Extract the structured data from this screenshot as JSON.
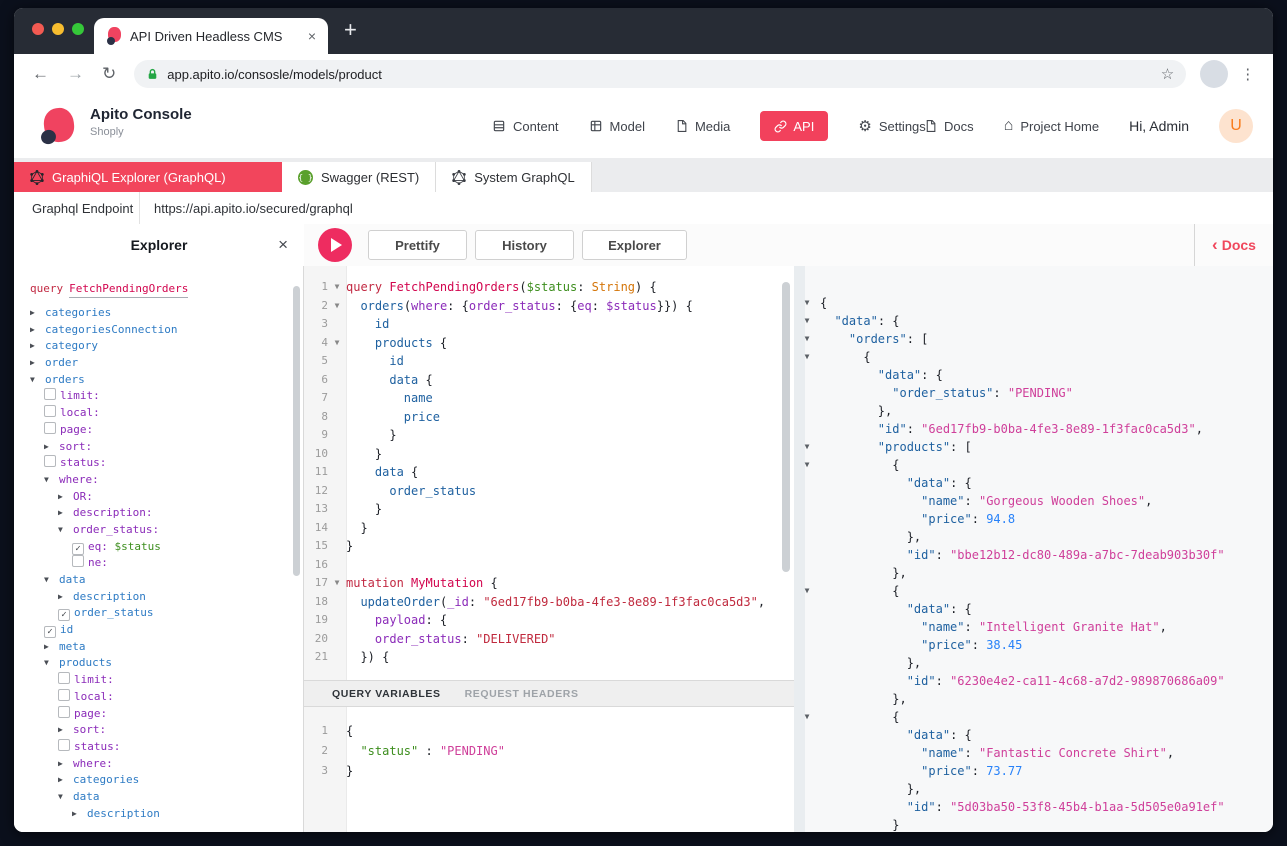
{
  "browser": {
    "tab_title": "API Driven Headless CMS",
    "close": "×",
    "new_tab": "+",
    "back": "←",
    "forward": "→",
    "reload": "↻",
    "url": "app.apito.io/consosle/models/product",
    "star": "☆",
    "menu": "⋮"
  },
  "header": {
    "brand": "Apito Console",
    "project": "Shoply",
    "nav": [
      {
        "label": "Content"
      },
      {
        "label": "Model"
      },
      {
        "label": "Media"
      },
      {
        "label": "API"
      },
      {
        "label": "Settings"
      }
    ],
    "settings_gear": "⚙",
    "right": {
      "docs": "Docs",
      "home_glyph": "⌂",
      "project_home": "Project Home",
      "greeting": "Hi, Admin",
      "avatar": "U"
    }
  },
  "api_tabs": [
    {
      "label": "GraphiQL Explorer (GraphQL)",
      "active": true
    },
    {
      "label": "Swagger (REST)",
      "active": false
    },
    {
      "label": "System GraphQL",
      "active": false
    }
  ],
  "endpoint": {
    "label": "Graphql Endpoint",
    "url": "https://api.apito.io/secured/graphql"
  },
  "toolbar": {
    "panel_title": "Explorer",
    "close": "×",
    "buttons": [
      "Prettify",
      "History",
      "Explorer"
    ],
    "docs_chevron": "‹",
    "docs_link": "Docs"
  },
  "explorer_tree": {
    "operation": "query",
    "operation_name": "FetchPendingOrders",
    "items": [
      {
        "ind": 0,
        "ctrl": "c",
        "label": "categories",
        "cls": "f"
      },
      {
        "ind": 0,
        "ctrl": "c",
        "label": "categoriesConnection",
        "cls": "f"
      },
      {
        "ind": 0,
        "ctrl": "c",
        "label": "category",
        "cls": "f"
      },
      {
        "ind": 0,
        "ctrl": "c",
        "label": "order",
        "cls": "f"
      },
      {
        "ind": 0,
        "ctrl": "o",
        "label": "orders",
        "cls": "f"
      },
      {
        "ind": 1,
        "ctrl": "b",
        "label": "limit:",
        "cls": "a"
      },
      {
        "ind": 1,
        "ctrl": "b",
        "label": "local:",
        "cls": "a"
      },
      {
        "ind": 1,
        "ctrl": "b",
        "label": "page:",
        "cls": "a"
      },
      {
        "ind": 1,
        "ctrl": "c",
        "label": "sort:",
        "cls": "a"
      },
      {
        "ind": 1,
        "ctrl": "b",
        "label": "status:",
        "cls": "a"
      },
      {
        "ind": 1,
        "ctrl": "o",
        "label": "where:",
        "cls": "a"
      },
      {
        "ind": 2,
        "ctrl": "c",
        "label": "OR:",
        "cls": "a"
      },
      {
        "ind": 2,
        "ctrl": "c",
        "label": "description:",
        "cls": "a"
      },
      {
        "ind": 2,
        "ctrl": "o",
        "label": "order_status:",
        "cls": "a"
      },
      {
        "ind": 3,
        "ctrl": "x",
        "label": "eq:",
        "cls": "a",
        "extra": "$status"
      },
      {
        "ind": 3,
        "ctrl": "b",
        "label": "ne:",
        "cls": "a"
      },
      {
        "ind": 1,
        "ctrl": "o",
        "label": "data",
        "cls": "f"
      },
      {
        "ind": 2,
        "ctrl": "c",
        "label": "description",
        "cls": "f"
      },
      {
        "ind": 2,
        "ctrl": "x",
        "label": "order_status",
        "cls": "f"
      },
      {
        "ind": 1,
        "ctrl": "x",
        "label": "id",
        "cls": "f"
      },
      {
        "ind": 1,
        "ctrl": "c",
        "label": "meta",
        "cls": "f"
      },
      {
        "ind": 1,
        "ctrl": "o",
        "label": "products",
        "cls": "f"
      },
      {
        "ind": 2,
        "ctrl": "b",
        "label": "limit:",
        "cls": "a"
      },
      {
        "ind": 2,
        "ctrl": "b",
        "label": "local:",
        "cls": "a"
      },
      {
        "ind": 2,
        "ctrl": "b",
        "label": "page:",
        "cls": "a"
      },
      {
        "ind": 2,
        "ctrl": "c",
        "label": "sort:",
        "cls": "a"
      },
      {
        "ind": 2,
        "ctrl": "b",
        "label": "status:",
        "cls": "a"
      },
      {
        "ind": 2,
        "ctrl": "c",
        "label": "where:",
        "cls": "a"
      },
      {
        "ind": 2,
        "ctrl": "c",
        "label": "categories",
        "cls": "f"
      },
      {
        "ind": 2,
        "ctrl": "o",
        "label": "data",
        "cls": "f"
      },
      {
        "ind": 3,
        "ctrl": "c",
        "label": "description",
        "cls": "f"
      }
    ]
  },
  "editor": {
    "lines": [
      {
        "n": 1,
        "fold": true,
        "seg": [
          [
            "k",
            "query "
          ],
          [
            "d",
            "FetchPendingOrders"
          ],
          [
            "p",
            "("
          ],
          [
            "v",
            "$status"
          ],
          [
            "p",
            ": "
          ],
          [
            "t",
            "String"
          ],
          [
            "p",
            ") {"
          ]
        ]
      },
      {
        "n": 2,
        "fold": true,
        "seg": [
          [
            "p",
            "  "
          ],
          [
            "f",
            "orders"
          ],
          [
            "p",
            "("
          ],
          [
            "a",
            "where"
          ],
          [
            "p",
            ": {"
          ],
          [
            "a",
            "order_status"
          ],
          [
            "p",
            ": {"
          ],
          [
            "a",
            "eq"
          ],
          [
            "p",
            ": "
          ],
          [
            "a",
            "$status"
          ],
          [
            "p",
            "}}) {"
          ]
        ]
      },
      {
        "n": 3,
        "fold": false,
        "seg": [
          [
            "p",
            "    "
          ],
          [
            "f",
            "id"
          ]
        ]
      },
      {
        "n": 4,
        "fold": true,
        "seg": [
          [
            "p",
            "    "
          ],
          [
            "f",
            "products"
          ],
          [
            "p",
            " {"
          ]
        ]
      },
      {
        "n": 5,
        "fold": false,
        "seg": [
          [
            "p",
            "      "
          ],
          [
            "f",
            "id"
          ]
        ]
      },
      {
        "n": 6,
        "fold": false,
        "seg": [
          [
            "p",
            "      "
          ],
          [
            "f",
            "data"
          ],
          [
            "p",
            " {"
          ]
        ]
      },
      {
        "n": 7,
        "fold": false,
        "seg": [
          [
            "p",
            "        "
          ],
          [
            "f",
            "name"
          ]
        ]
      },
      {
        "n": 8,
        "fold": false,
        "seg": [
          [
            "p",
            "        "
          ],
          [
            "f",
            "price"
          ]
        ]
      },
      {
        "n": 9,
        "fold": false,
        "seg": [
          [
            "p",
            "      }"
          ]
        ]
      },
      {
        "n": 10,
        "fold": false,
        "seg": [
          [
            "p",
            "    }"
          ]
        ]
      },
      {
        "n": 11,
        "fold": false,
        "seg": [
          [
            "p",
            "    "
          ],
          [
            "f",
            "data"
          ],
          [
            "p",
            " {"
          ]
        ]
      },
      {
        "n": 12,
        "fold": false,
        "seg": [
          [
            "p",
            "      "
          ],
          [
            "f",
            "order_status"
          ]
        ]
      },
      {
        "n": 13,
        "fold": false,
        "seg": [
          [
            "p",
            "    }"
          ]
        ]
      },
      {
        "n": 14,
        "fold": false,
        "seg": [
          [
            "p",
            "  }"
          ]
        ]
      },
      {
        "n": 15,
        "fold": false,
        "seg": [
          [
            "p",
            "}"
          ]
        ]
      },
      {
        "n": 16,
        "fold": false,
        "seg": []
      },
      {
        "n": 17,
        "fold": true,
        "seg": [
          [
            "k",
            "mutation "
          ],
          [
            "d",
            "MyMutation"
          ],
          [
            "p",
            " {"
          ]
        ]
      },
      {
        "n": 18,
        "fold": false,
        "seg": [
          [
            "p",
            "  "
          ],
          [
            "f",
            "updateOrder"
          ],
          [
            "p",
            "("
          ],
          [
            "a",
            "_id"
          ],
          [
            "p",
            ": "
          ],
          [
            "s",
            "\"6ed17fb9-b0ba-4fe3-8e89-1f3fac0ca5d3\""
          ],
          [
            "p",
            ","
          ]
        ]
      },
      {
        "n": 19,
        "fold": false,
        "seg": [
          [
            "p",
            "    "
          ],
          [
            "a",
            "payload"
          ],
          [
            "p",
            ": {"
          ]
        ]
      },
      {
        "n": 20,
        "fold": false,
        "seg": [
          [
            "p",
            "    "
          ],
          [
            "a",
            "order_status"
          ],
          [
            "p",
            ": "
          ],
          [
            "s",
            "\"DELIVERED\""
          ]
        ]
      },
      {
        "n": 21,
        "fold": false,
        "seg": [
          [
            "p",
            "  }) {"
          ]
        ]
      }
    ]
  },
  "variables": {
    "tabs": [
      "QUERY VARIABLES",
      "REQUEST HEADERS"
    ],
    "lines": [
      {
        "n": 1,
        "seg": [
          [
            "p",
            "{"
          ]
        ]
      },
      {
        "n": 2,
        "seg": [
          [
            "p",
            "  "
          ],
          [
            "v",
            "\"status\""
          ],
          [
            "p",
            " : "
          ],
          [
            "rs",
            "\"PENDING\""
          ]
        ]
      },
      {
        "n": 3,
        "seg": [
          [
            "p",
            "}"
          ]
        ]
      }
    ]
  },
  "response": {
    "lines": [
      {
        "fold": true,
        "seg": [
          [
            "p",
            "{"
          ]
        ]
      },
      {
        "fold": true,
        "seg": [
          [
            "p",
            "  "
          ],
          [
            "rk",
            "\"data\""
          ],
          [
            "p",
            ": {"
          ]
        ]
      },
      {
        "fold": true,
        "seg": [
          [
            "p",
            "    "
          ],
          [
            "rk",
            "\"orders\""
          ],
          [
            "p",
            ": ["
          ]
        ]
      },
      {
        "fold": true,
        "seg": [
          [
            "p",
            "      {"
          ]
        ]
      },
      {
        "fold": false,
        "seg": [
          [
            "p",
            "        "
          ],
          [
            "rk",
            "\"data\""
          ],
          [
            "p",
            ": {"
          ]
        ]
      },
      {
        "fold": false,
        "seg": [
          [
            "p",
            "          "
          ],
          [
            "rk",
            "\"order_status\""
          ],
          [
            "p",
            ": "
          ],
          [
            "rs",
            "\"PENDING\""
          ]
        ]
      },
      {
        "fold": false,
        "seg": [
          [
            "p",
            "        },"
          ]
        ]
      },
      {
        "fold": false,
        "seg": [
          [
            "p",
            "        "
          ],
          [
            "rk",
            "\"id\""
          ],
          [
            "p",
            ": "
          ],
          [
            "rs",
            "\"6ed17fb9-b0ba-4fe3-8e89-1f3fac0ca5d3\""
          ],
          [
            "p",
            ","
          ]
        ]
      },
      {
        "fold": true,
        "seg": [
          [
            "p",
            "        "
          ],
          [
            "rk",
            "\"products\""
          ],
          [
            "p",
            ": ["
          ]
        ]
      },
      {
        "fold": true,
        "seg": [
          [
            "p",
            "          {"
          ]
        ]
      },
      {
        "fold": false,
        "seg": [
          [
            "p",
            "            "
          ],
          [
            "rk",
            "\"data\""
          ],
          [
            "p",
            ": {"
          ]
        ]
      },
      {
        "fold": false,
        "seg": [
          [
            "p",
            "              "
          ],
          [
            "rk",
            "\"name\""
          ],
          [
            "p",
            ": "
          ],
          [
            "rs",
            "\"Gorgeous Wooden Shoes\""
          ],
          [
            "p",
            ","
          ]
        ]
      },
      {
        "fold": false,
        "seg": [
          [
            "p",
            "              "
          ],
          [
            "rk",
            "\"price\""
          ],
          [
            "p",
            ": "
          ],
          [
            "rn",
            "94.8"
          ]
        ]
      },
      {
        "fold": false,
        "seg": [
          [
            "p",
            "            },"
          ]
        ]
      },
      {
        "fold": false,
        "seg": [
          [
            "p",
            "            "
          ],
          [
            "rk",
            "\"id\""
          ],
          [
            "p",
            ": "
          ],
          [
            "rs",
            "\"bbe12b12-dc80-489a-a7bc-7deab903b30f\""
          ]
        ]
      },
      {
        "fold": false,
        "seg": [
          [
            "p",
            "          },"
          ]
        ]
      },
      {
        "fold": true,
        "seg": [
          [
            "p",
            "          {"
          ]
        ]
      },
      {
        "fold": false,
        "seg": [
          [
            "p",
            "            "
          ],
          [
            "rk",
            "\"data\""
          ],
          [
            "p",
            ": {"
          ]
        ]
      },
      {
        "fold": false,
        "seg": [
          [
            "p",
            "              "
          ],
          [
            "rk",
            "\"name\""
          ],
          [
            "p",
            ": "
          ],
          [
            "rs",
            "\"Intelligent Granite Hat\""
          ],
          [
            "p",
            ","
          ]
        ]
      },
      {
        "fold": false,
        "seg": [
          [
            "p",
            "              "
          ],
          [
            "rk",
            "\"price\""
          ],
          [
            "p",
            ": "
          ],
          [
            "rn",
            "38.45"
          ]
        ]
      },
      {
        "fold": false,
        "seg": [
          [
            "p",
            "            },"
          ]
        ]
      },
      {
        "fold": false,
        "seg": [
          [
            "p",
            "            "
          ],
          [
            "rk",
            "\"id\""
          ],
          [
            "p",
            ": "
          ],
          [
            "rs",
            "\"6230e4e2-ca11-4c68-a7d2-989870686a09\""
          ]
        ]
      },
      {
        "fold": false,
        "seg": [
          [
            "p",
            "          },"
          ]
        ]
      },
      {
        "fold": true,
        "seg": [
          [
            "p",
            "          {"
          ]
        ]
      },
      {
        "fold": false,
        "seg": [
          [
            "p",
            "            "
          ],
          [
            "rk",
            "\"data\""
          ],
          [
            "p",
            ": {"
          ]
        ]
      },
      {
        "fold": false,
        "seg": [
          [
            "p",
            "              "
          ],
          [
            "rk",
            "\"name\""
          ],
          [
            "p",
            ": "
          ],
          [
            "rs",
            "\"Fantastic Concrete Shirt\""
          ],
          [
            "p",
            ","
          ]
        ]
      },
      {
        "fold": false,
        "seg": [
          [
            "p",
            "              "
          ],
          [
            "rk",
            "\"price\""
          ],
          [
            "p",
            ": "
          ],
          [
            "rn",
            "73.77"
          ]
        ]
      },
      {
        "fold": false,
        "seg": [
          [
            "p",
            "            },"
          ]
        ]
      },
      {
        "fold": false,
        "seg": [
          [
            "p",
            "            "
          ],
          [
            "rk",
            "\"id\""
          ],
          [
            "p",
            ": "
          ],
          [
            "rs",
            "\"5d03ba50-53f8-45b4-b1aa-5d505e0a91ef\""
          ]
        ]
      },
      {
        "fold": false,
        "seg": [
          [
            "p",
            "          }"
          ]
        ]
      }
    ]
  }
}
